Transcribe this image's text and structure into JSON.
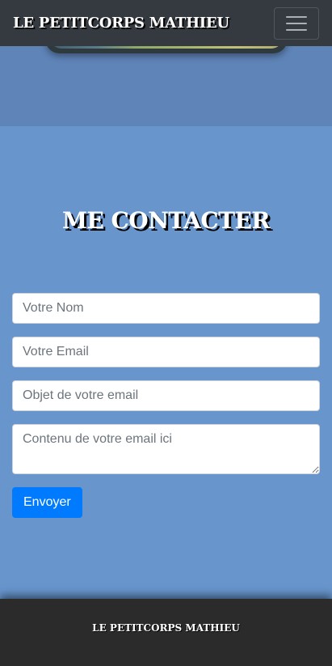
{
  "navbar": {
    "brand": "LE PETITCORPS MATHIEU",
    "toggle_icon": "hamburger-menu-icon"
  },
  "contact": {
    "title": "ME CONTACTER",
    "name_placeholder": "Votre Nom",
    "email_placeholder": "Votre Email",
    "subject_placeholder": "Objet de votre email",
    "message_placeholder": "Contenu de votre email ici",
    "submit_label": "Envoyer"
  },
  "footer": {
    "text": "LE PETITCORPS MATHIEU"
  },
  "colors": {
    "navbar_bg": "#343a40",
    "section_bg": "#6795cc",
    "top_section_bg": "#5f84b8",
    "button_primary": "#007bff",
    "footer_bg": "#2b2b2b"
  }
}
